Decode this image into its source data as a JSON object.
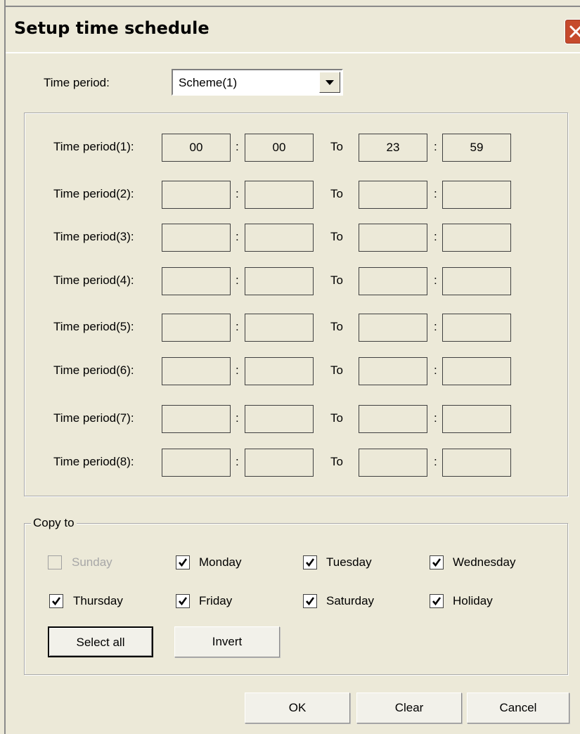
{
  "window": {
    "title": "Setup time schedule"
  },
  "time_period_select": {
    "label": "Time period:",
    "value": "Scheme(1)"
  },
  "periods": [
    {
      "label": "Time period(1):",
      "start_h": "00",
      "start_m": "00",
      "to": "To",
      "end_h": "23",
      "end_m": "59"
    },
    {
      "label": "Time period(2):",
      "start_h": "",
      "start_m": "",
      "to": "To",
      "end_h": "",
      "end_m": ""
    },
    {
      "label": "Time period(3):",
      "start_h": "",
      "start_m": "",
      "to": "To",
      "end_h": "",
      "end_m": ""
    },
    {
      "label": "Time period(4):",
      "start_h": "",
      "start_m": "",
      "to": "To",
      "end_h": "",
      "end_m": ""
    },
    {
      "label": "Time period(5):",
      "start_h": "",
      "start_m": "",
      "to": "To",
      "end_h": "",
      "end_m": ""
    },
    {
      "label": "Time period(6):",
      "start_h": "",
      "start_m": "",
      "to": "To",
      "end_h": "",
      "end_m": ""
    },
    {
      "label": "Time period(7):",
      "start_h": "",
      "start_m": "",
      "to": "To",
      "end_h": "",
      "end_m": ""
    },
    {
      "label": "Time period(8):",
      "start_h": "",
      "start_m": "",
      "to": "To",
      "end_h": "",
      "end_m": ""
    }
  ],
  "separator": ":",
  "copy_to": {
    "legend": "Copy to",
    "days": [
      {
        "label": "Sunday",
        "checked": false,
        "disabled": true
      },
      {
        "label": "Monday",
        "checked": true,
        "disabled": false
      },
      {
        "label": "Tuesday",
        "checked": true,
        "disabled": false
      },
      {
        "label": "Wednesday",
        "checked": true,
        "disabled": false
      },
      {
        "label": "Thursday",
        "checked": true,
        "disabled": false
      },
      {
        "label": "Friday",
        "checked": true,
        "disabled": false
      },
      {
        "label": "Saturday",
        "checked": true,
        "disabled": false
      },
      {
        "label": "Holiday",
        "checked": true,
        "disabled": false
      }
    ],
    "select_all_label": "Select all",
    "invert_label": "Invert"
  },
  "footer": {
    "ok_label": "OK",
    "clear_label": "Clear",
    "cancel_label": "Cancel"
  },
  "colors": {
    "dialog_bg": "#ece9d8",
    "close_button": "#c64a2c",
    "disabled_text": "#a7a7a7"
  },
  "icons": {
    "close": "close-x-icon",
    "dropdown": "dropdown-arrow-icon",
    "check": "checkmark-icon"
  }
}
